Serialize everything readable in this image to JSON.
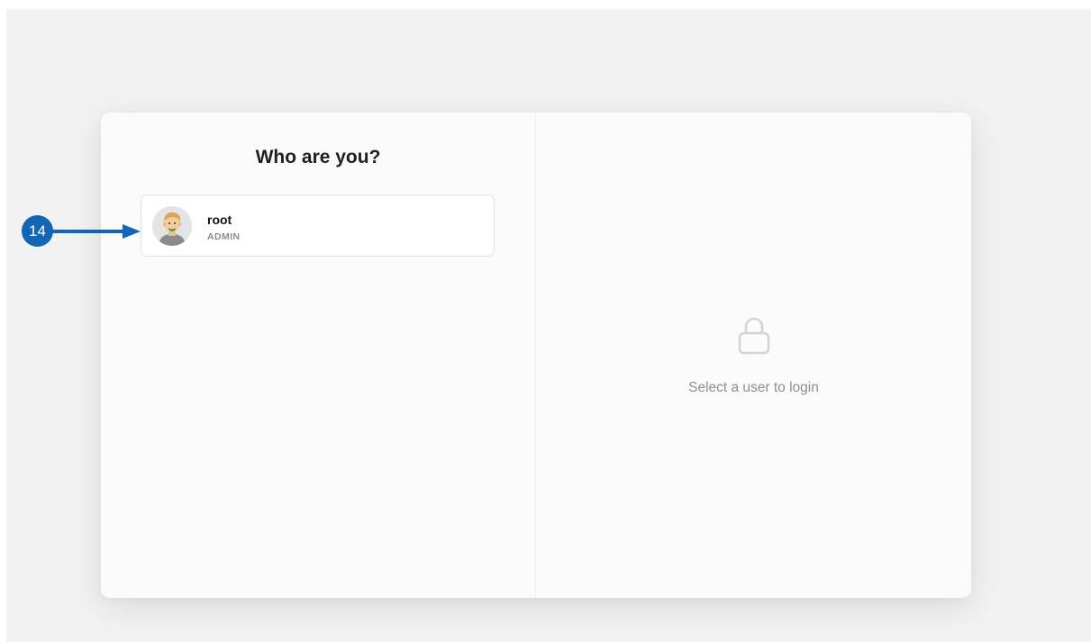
{
  "login": {
    "title": "Who are you?",
    "users": [
      {
        "name": "root",
        "role": "ADMIN",
        "avatar_icon": "user-avatar-icon"
      }
    ],
    "empty_state": {
      "icon": "lock-icon",
      "message": "Select a user to login"
    }
  },
  "annotation": {
    "marker_label": "14",
    "color": "#1266b5"
  }
}
